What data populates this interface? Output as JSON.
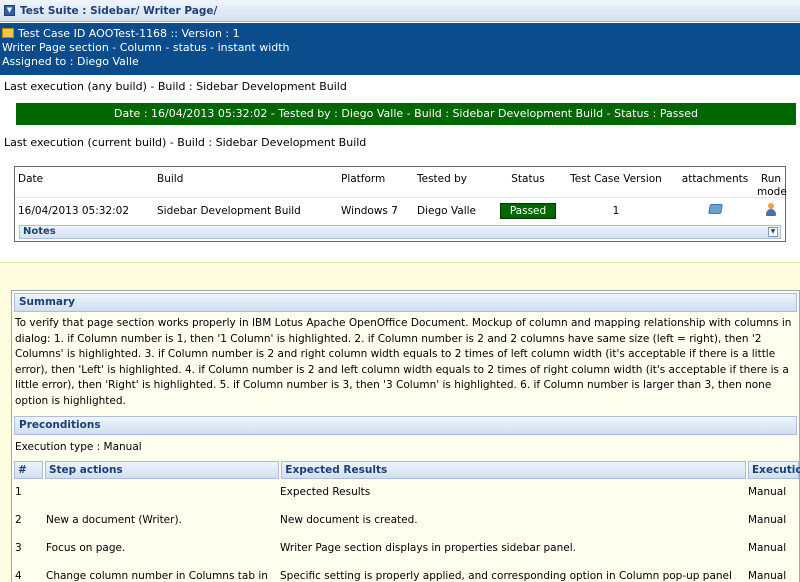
{
  "suite": {
    "toggle": "▼",
    "title": "Test Suite : Sidebar/ Writer Page/"
  },
  "testcase": {
    "id_line": "Test Case ID AOOTest-1168 :: Version : 1",
    "name_line": "Writer Page section - Column - status - instant width",
    "assigned_line": "Assigned to : Diego Valle"
  },
  "last_any": "Last execution (any build) - Build : Sidebar Development Build",
  "date_bar": "Date : 16/04/2013 05:32:02 - Tested by : Diego Valle - Build : Sidebar Development Build - Status : Passed",
  "last_current": "Last execution (current build) - Build : Sidebar Development Build",
  "exec_table": {
    "headers": {
      "date": "Date",
      "build": "Build",
      "platform": "Platform",
      "tested_by": "Tested by",
      "status": "Status",
      "version": "Test Case Version",
      "attachments": "attachments",
      "run_mode": "Run mode"
    },
    "row": {
      "date": "16/04/2013 05:32:02",
      "build": "Sidebar Development Build",
      "platform": "Windows 7",
      "tested_by": "Diego Valle",
      "status": "Passed",
      "version": "1"
    },
    "notes_label": "Notes",
    "notes_toggle": "▼"
  },
  "colors": {
    "header_blue": "#0a4c8c",
    "passed_green": "#006600",
    "section_text": "#1f3f73"
  },
  "spec": {
    "summary_title": "Summary",
    "summary_text": "To verify that page section works properly in IBM Lotus Apache OpenOffice Document. Mockup of column and mapping relationship with columns in dialog: 1. if Column number is 1, then '1 Column' is highlighted. 2. if Column number is 2 and 2 columns have same size (left = right), then '2 Columns' is highlighted. 3. if Column number is 2 and right column width equals to 2 times of left column width (it's acceptable if there is a little error), then 'Left' is highlighted. 4. if Column number is 2 and left column width equals to 2 times of right column width (it's acceptable if there is a little error), then 'Right' is highlighted. 5. if Column number is 3, then '3 Column' is highlighted. 6. if Column number is larger than 3, then none option is highlighted.",
    "preconditions_title": "Preconditions",
    "execution_type": "Execution type : Manual",
    "steps_headers": {
      "num": "#",
      "actions": "Step actions",
      "expected": "Expected Results",
      "execution": "Execution"
    },
    "steps": [
      {
        "num": "1",
        "action": "",
        "expected": "Expected Results",
        "execution": "Manual"
      },
      {
        "num": "2",
        "action": "New a document (Writer).",
        "expected": "New document is created.",
        "execution": "Manual"
      },
      {
        "num": "3",
        "action": "Focus on page.",
        "expected": "Writer Page section displays in properties sidebar panel.",
        "execution": "Manual"
      },
      {
        "num": "4",
        "action": "Change column number in Columns tab in Page",
        "expected": "Specific setting is properly applied, and corresponding option in Column pop-up panel should be",
        "execution": "Manual"
      }
    ]
  }
}
